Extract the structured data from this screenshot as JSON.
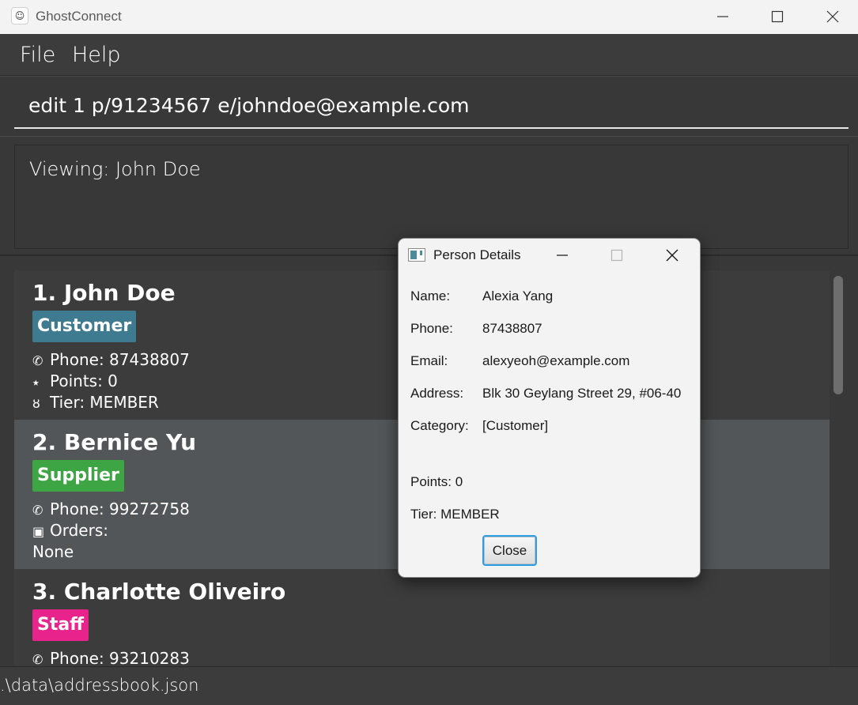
{
  "window": {
    "app_icon": "ghost-icon",
    "title": "GhostConnect"
  },
  "menu": {
    "file": "File",
    "help": "Help"
  },
  "command": {
    "value": "edit 1 p/91234567 e/johndoe@example.com"
  },
  "result": {
    "text": "Viewing: John Doe"
  },
  "persons": [
    {
      "name": "1. John Doe",
      "tag": "Customer",
      "fields": [
        {
          "icon": "phone-icon",
          "glyph": "✆",
          "text": "Phone: 87438807"
        },
        {
          "icon": "star-icon",
          "glyph": "⭑",
          "text": "Points: 0"
        },
        {
          "icon": "medal-icon",
          "glyph": "ȣ",
          "text": "Tier: MEMBER"
        }
      ]
    },
    {
      "name": "2. Bernice Yu",
      "tag": "Supplier",
      "fields": [
        {
          "icon": "phone-icon",
          "glyph": "✆",
          "text": "Phone: 99272758"
        },
        {
          "icon": "gift-icon",
          "glyph": "▣",
          "text": "Orders:"
        },
        {
          "icon": "",
          "glyph": "",
          "text": "None"
        }
      ]
    },
    {
      "name": "3. Charlotte Oliveiro",
      "tag": "Staff",
      "fields": [
        {
          "icon": "phone-icon",
          "glyph": "✆",
          "text": "Phone: 93210283"
        }
      ]
    }
  ],
  "status": {
    "path": ".\\data\\addressbook.json"
  },
  "dialog": {
    "title": "Person Details",
    "name_label": "Name:",
    "name_value": "Alexia Yang",
    "phone_label": "Phone:",
    "phone_value": "87438807",
    "email_label": "Email:",
    "email_value": "alexyeoh@example.com",
    "address_label": "Address:",
    "address_value": "Blk 30 Geylang Street 29, #06-40",
    "category_label": "Category:",
    "category_value": "[Customer]",
    "points": "Points: 0",
    "tier": "Tier: MEMBER",
    "close_label": "Close"
  },
  "colors": {
    "customer_tag": "#3e7b91",
    "supplier_tag": "#3ea545",
    "staff_tag": "#e8238c",
    "focus_accent": "#2b9ee6"
  }
}
